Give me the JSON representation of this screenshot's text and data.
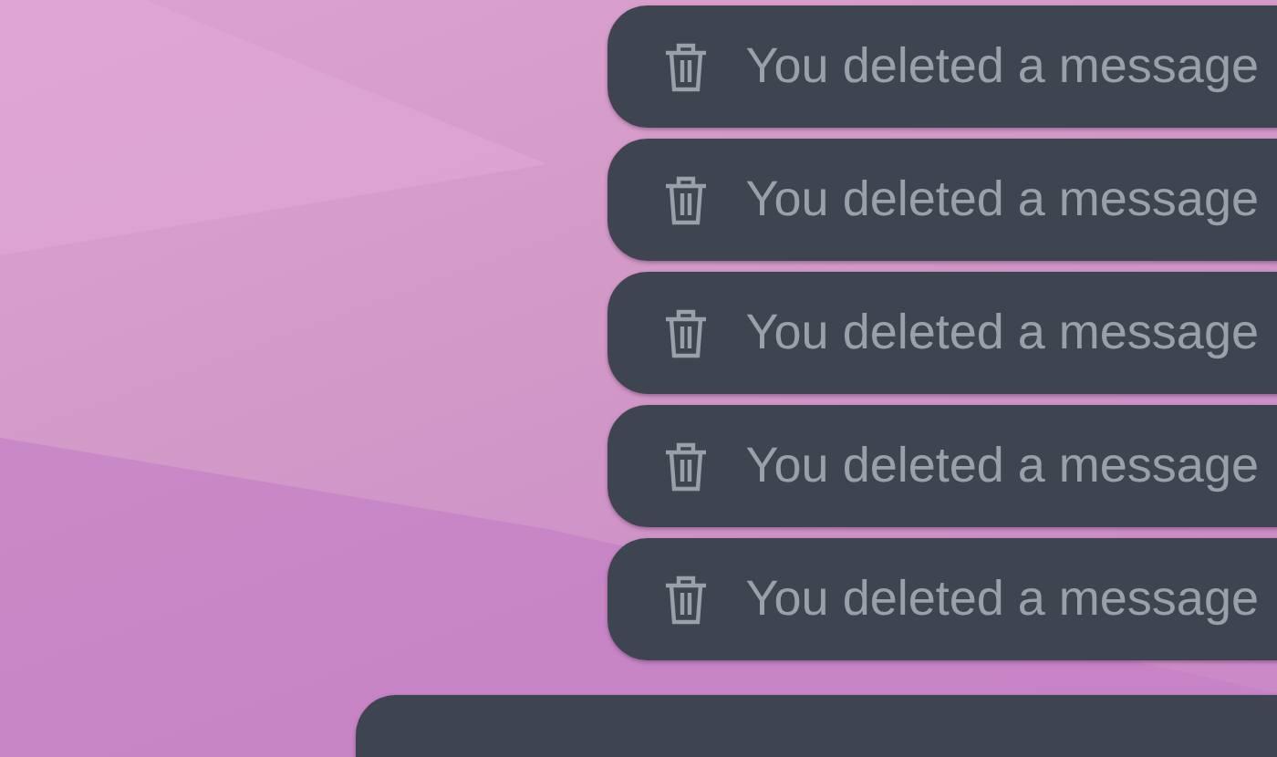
{
  "messages": [
    {
      "kind": "deleted",
      "text": "You deleted a message"
    },
    {
      "kind": "deleted",
      "text": "You deleted a message"
    },
    {
      "kind": "deleted",
      "text": "You deleted a message"
    },
    {
      "kind": "deleted",
      "text": "You deleted a message"
    },
    {
      "kind": "deleted",
      "text": "You deleted a message"
    },
    {
      "kind": "cut_off"
    }
  ]
}
